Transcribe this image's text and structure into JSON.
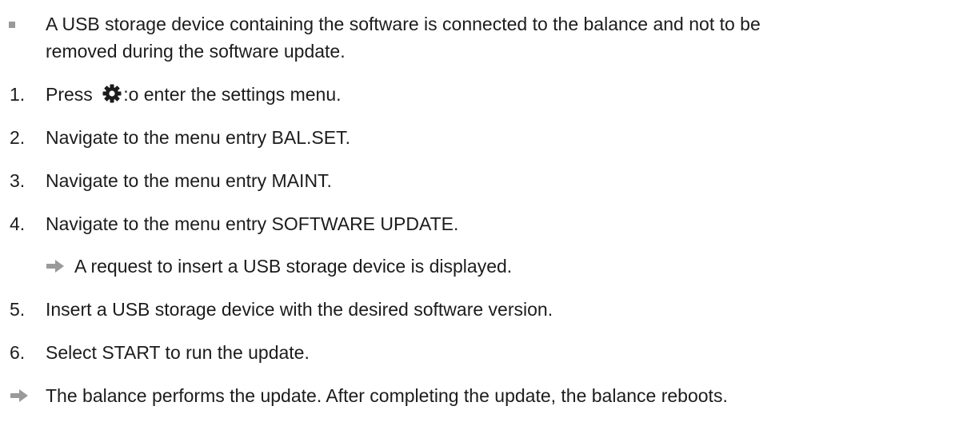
{
  "precondition": {
    "text_line1": "A USB storage device containing the software is connected to the balance and not to be",
    "text_line2": "removed during the software update."
  },
  "steps": [
    {
      "number": "1.",
      "before_icon": "Press ",
      "icon": "gear-icon",
      "after_icon": ":o enter the settings menu."
    },
    {
      "number": "2.",
      "text": "Navigate to the menu entry BAL.SET."
    },
    {
      "number": "3.",
      "text": "Navigate to the menu entry MAINT."
    },
    {
      "number": "4.",
      "text": "Navigate to the menu entry SOFTWARE UPDATE."
    },
    {
      "number": "5.",
      "text": "Insert a USB storage device with the desired software version."
    },
    {
      "number": "6.",
      "text": "Select START to run the update."
    }
  ],
  "intermediate_result": {
    "icon": "arrow-right-icon",
    "text": "A request to insert a USB storage device is displayed."
  },
  "final_result": {
    "icon": "arrow-right-icon",
    "text": "The balance performs the update. After completing the update, the balance reboots."
  },
  "colors": {
    "text": "#1c1c1c",
    "bullet": "#9a9a9a",
    "arrow": "#9a9a9a"
  }
}
